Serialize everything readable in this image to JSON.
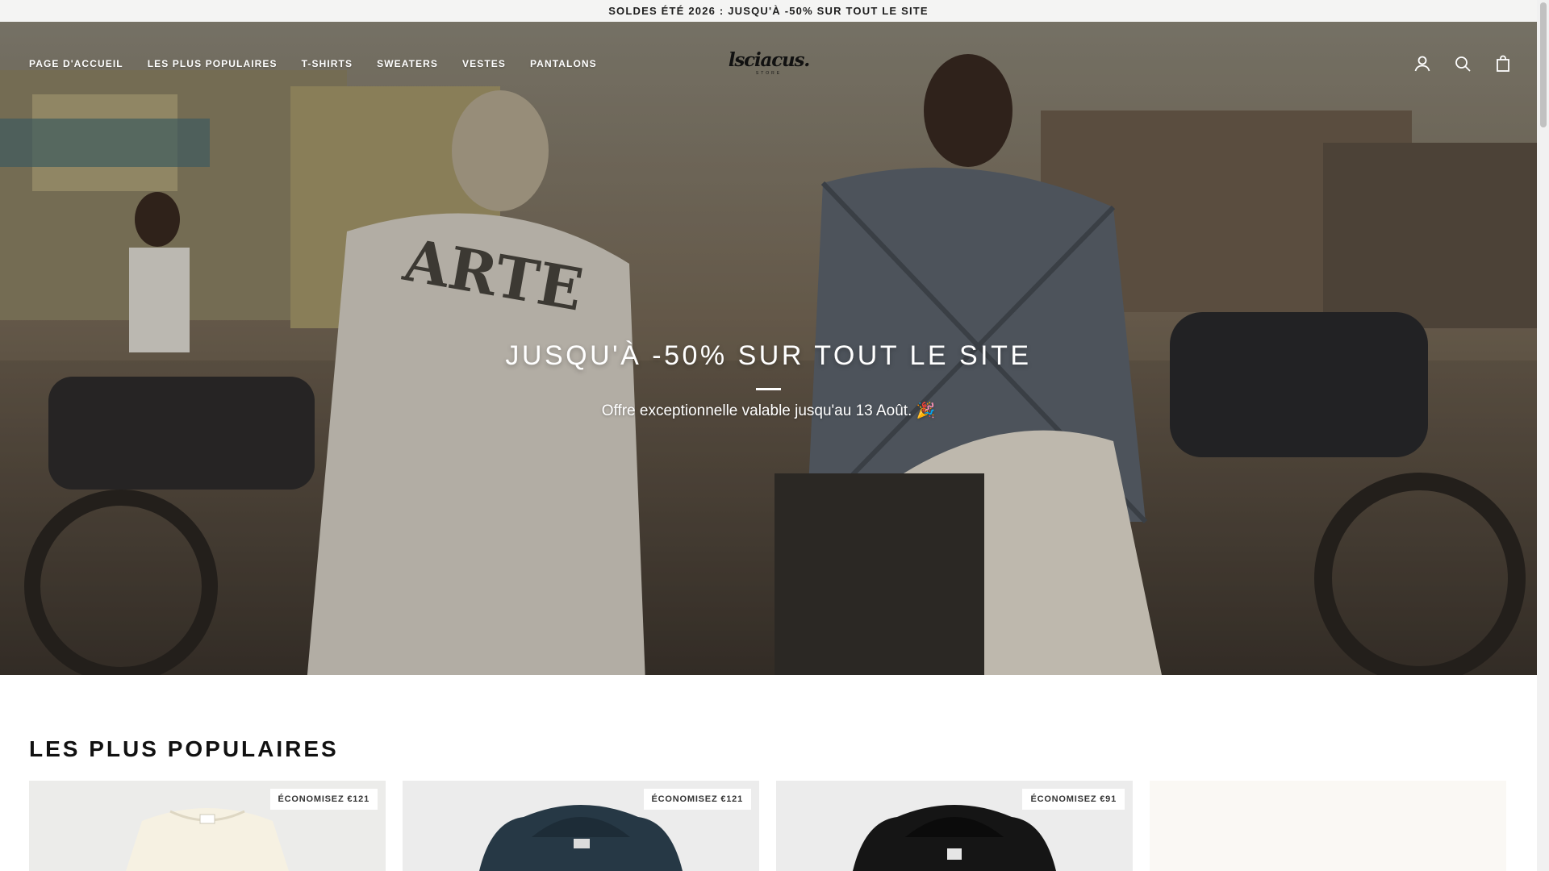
{
  "announcement": {
    "text": "SOLDES ÉTÉ 2026 : JUSQU'À -50% SUR TOUT LE SITE"
  },
  "header": {
    "nav": [
      {
        "label": "PAGE D'ACCUEIL"
      },
      {
        "label": "LES PLUS POPULAIRES"
      },
      {
        "label": "T-SHIRTS"
      },
      {
        "label": "SWEATERS"
      },
      {
        "label": "VESTES"
      },
      {
        "label": "PANTALONS"
      }
    ],
    "logo": {
      "text": "lsciacus.",
      "subtext": "STORE"
    },
    "icons": [
      "account-icon",
      "search-icon",
      "cart-icon"
    ]
  },
  "hero": {
    "title": "JUSQU'À -50% SUR TOUT LE SITE",
    "subtitle": "Offre exceptionnelle valable jusqu'au 13 Août. 🎉"
  },
  "popular": {
    "title": "LES PLUS POPULAIRES",
    "products": [
      {
        "badge": "ÉCONOMISEZ €121",
        "image": "cream-knit-polo"
      },
      {
        "badge": "ÉCONOMISEZ €121",
        "image": "navy-hoodie"
      },
      {
        "badge": "ÉCONOMISEZ €91",
        "image": "black-hoodie"
      },
      {
        "badge": "",
        "image": "light-product-placeholder"
      }
    ]
  },
  "colors": {
    "announcement_bg": "#f4f4f3",
    "text_dark": "#111111",
    "hero_text": "#ffffff",
    "card_bg_light": "#efefef",
    "card_bg_cream": "#faf8f4"
  }
}
